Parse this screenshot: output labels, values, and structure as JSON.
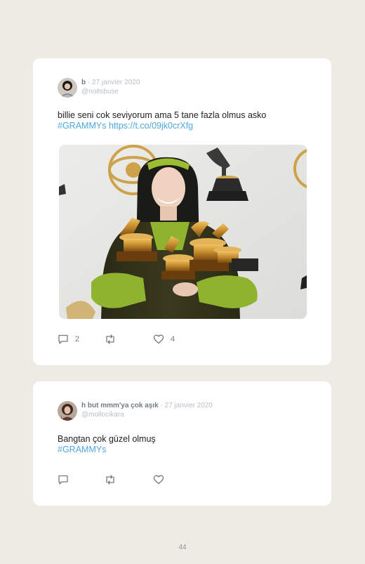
{
  "tweets": [
    {
      "display_name": "b",
      "date": "27 janvier 2020",
      "handle": "@noitsbuse",
      "text_line1": "billie seni cok seviyorum ama 5 tane fazla olmus asko",
      "hashtag": "#GRAMMYs",
      "link": "https://t.co/09jk0crXfg",
      "reply_count": "2",
      "like_count": "4"
    },
    {
      "display_name": "h but mmm'ya çok aşık",
      "date": "27 janvier 2020",
      "handle": "@mollocikara",
      "text_line1": "Bangtan çok güzel olmuş",
      "hashtag": "#GRAMMYs"
    }
  ],
  "separator": "·",
  "page_number": "44",
  "icons": [
    "reply-icon",
    "retweet-icon",
    "like-icon"
  ],
  "colors": {
    "background": "#eeebe3",
    "card": "#ffffff",
    "link": "#4fa8de",
    "muted": "#b7bfc6",
    "name": "#6f7c85"
  }
}
